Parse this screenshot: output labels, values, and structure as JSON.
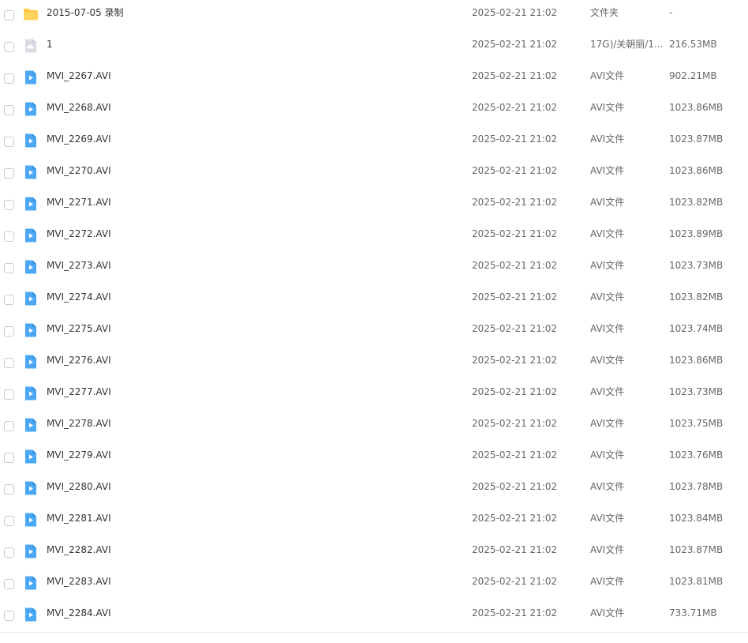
{
  "files": [
    {
      "icon": "folder-icon",
      "name": "2015-07-05 录制",
      "date": "2025-02-21 21:02",
      "type": "文件夹",
      "size": "-"
    },
    {
      "icon": "cloud-file-icon",
      "name": "1",
      "date": "2025-02-21 21:02",
      "type": "17G)/关朝丽/1...",
      "size": "216.53MB"
    },
    {
      "icon": "video-file-icon",
      "name": "MVI_2267.AVI",
      "date": "2025-02-21 21:02",
      "type": "AVI文件",
      "size": "902.21MB"
    },
    {
      "icon": "video-file-icon",
      "name": "MVI_2268.AVI",
      "date": "2025-02-21 21:02",
      "type": "AVI文件",
      "size": "1023.86MB"
    },
    {
      "icon": "video-file-icon",
      "name": "MVI_2269.AVI",
      "date": "2025-02-21 21:02",
      "type": "AVI文件",
      "size": "1023.87MB"
    },
    {
      "icon": "video-file-icon",
      "name": "MVI_2270.AVI",
      "date": "2025-02-21 21:02",
      "type": "AVI文件",
      "size": "1023.86MB"
    },
    {
      "icon": "video-file-icon",
      "name": "MVI_2271.AVI",
      "date": "2025-02-21 21:02",
      "type": "AVI文件",
      "size": "1023.82MB"
    },
    {
      "icon": "video-file-icon",
      "name": "MVI_2272.AVI",
      "date": "2025-02-21 21:02",
      "type": "AVI文件",
      "size": "1023.89MB"
    },
    {
      "icon": "video-file-icon",
      "name": "MVI_2273.AVI",
      "date": "2025-02-21 21:02",
      "type": "AVI文件",
      "size": "1023.73MB"
    },
    {
      "icon": "video-file-icon",
      "name": "MVI_2274.AVI",
      "date": "2025-02-21 21:02",
      "type": "AVI文件",
      "size": "1023.82MB"
    },
    {
      "icon": "video-file-icon",
      "name": "MVI_2275.AVI",
      "date": "2025-02-21 21:02",
      "type": "AVI文件",
      "size": "1023.74MB"
    },
    {
      "icon": "video-file-icon",
      "name": "MVI_2276.AVI",
      "date": "2025-02-21 21:02",
      "type": "AVI文件",
      "size": "1023.86MB"
    },
    {
      "icon": "video-file-icon",
      "name": "MVI_2277.AVI",
      "date": "2025-02-21 21:02",
      "type": "AVI文件",
      "size": "1023.73MB"
    },
    {
      "icon": "video-file-icon",
      "name": "MVI_2278.AVI",
      "date": "2025-02-21 21:02",
      "type": "AVI文件",
      "size": "1023.75MB"
    },
    {
      "icon": "video-file-icon",
      "name": "MVI_2279.AVI",
      "date": "2025-02-21 21:02",
      "type": "AVI文件",
      "size": "1023.76MB"
    },
    {
      "icon": "video-file-icon",
      "name": "MVI_2280.AVI",
      "date": "2025-02-21 21:02",
      "type": "AVI文件",
      "size": "1023.78MB"
    },
    {
      "icon": "video-file-icon",
      "name": "MVI_2281.AVI",
      "date": "2025-02-21 21:02",
      "type": "AVI文件",
      "size": "1023.84MB"
    },
    {
      "icon": "video-file-icon",
      "name": "MVI_2282.AVI",
      "date": "2025-02-21 21:02",
      "type": "AVI文件",
      "size": "1023.87MB"
    },
    {
      "icon": "video-file-icon",
      "name": "MVI_2283.AVI",
      "date": "2025-02-21 21:02",
      "type": "AVI文件",
      "size": "1023.81MB"
    },
    {
      "icon": "video-file-icon",
      "name": "MVI_2284.AVI",
      "date": "2025-02-21 21:02",
      "type": "AVI文件",
      "size": "733.71MB"
    }
  ],
  "colors": {
    "folder": "#FFC83D",
    "video": "#4AA8F5",
    "cloud": "#D9DCE2"
  }
}
